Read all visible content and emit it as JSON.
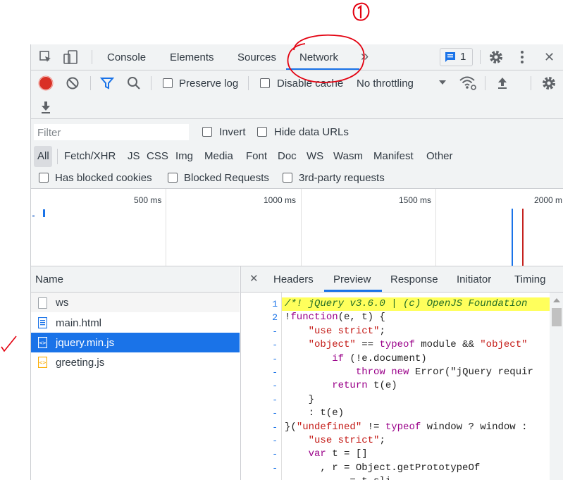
{
  "annotation": {
    "mark": "1"
  },
  "topbar": {
    "tabs": [
      "Console",
      "Elements",
      "Sources",
      "Network"
    ],
    "more_glyph": "»",
    "messages_count": "1",
    "close_glyph": "✕"
  },
  "toolbar": {
    "preserve_log": "Preserve log",
    "disable_cache": "Disable cache",
    "throttling": "No throttling"
  },
  "filterbar": {
    "filter_placeholder": "Filter",
    "invert": "Invert",
    "hide_data_urls": "Hide data URLs",
    "types": [
      "All",
      "Fetch/XHR",
      "JS",
      "CSS",
      "Img",
      "Media",
      "Font",
      "Doc",
      "WS",
      "Wasm",
      "Manifest",
      "Other"
    ],
    "has_blocked_cookies": "Has blocked cookies",
    "blocked_requests": "Blocked Requests",
    "third_party": "3rd-party requests"
  },
  "timeline": {
    "ticks": [
      "500 ms",
      "1000 ms",
      "1500 ms",
      "2000 m"
    ]
  },
  "requests": {
    "header": "Name",
    "items": [
      "ws",
      "main.html",
      "jquery.min.js",
      "greeting.js"
    ],
    "selected": "jquery.min.js"
  },
  "details": {
    "close_glyph": "✕",
    "tabs": [
      "Headers",
      "Preview",
      "Response",
      "Initiator",
      "Timing"
    ],
    "active_tab": "Preview",
    "line_numbers": [
      "1",
      "2",
      "-",
      "-",
      "-",
      "-",
      "-",
      "-",
      "-",
      "-",
      "-",
      "-",
      "-",
      "-"
    ],
    "code": [
      "/*! jQuery v3.6.0 | (c) OpenJS Foundation",
      "!function(e, t) {",
      "    \"use strict\";",
      "    \"object\" == typeof module && \"object\"",
      "        if (!e.document)",
      "            throw new Error(\"jQuery requir",
      "        return t(e)",
      "    }",
      "    : t(e)",
      "}(\"undefined\" != typeof window ? window :",
      "    \"use strict\";",
      "    var t = []",
      "      , r = Object.getPrototypeOf",
      "           = t.sli"
    ]
  },
  "colors": {
    "accent": "#1a73e8",
    "record": "#d93025",
    "annotation": "#e3000f",
    "selected_row": "#1a73e8",
    "highlight": "#ffff5c"
  }
}
